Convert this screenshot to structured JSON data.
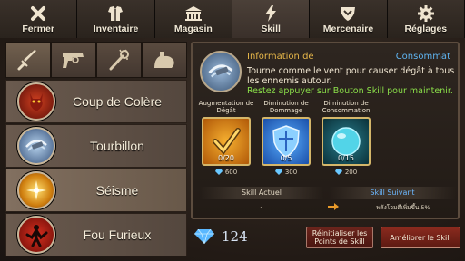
{
  "tabs": [
    {
      "id": "fermer",
      "label": "Fermer",
      "icon": "close-icon",
      "active": false
    },
    {
      "id": "inventaire",
      "label": "Inventaire",
      "icon": "armor-icon",
      "active": false
    },
    {
      "id": "magasin",
      "label": "Magasin",
      "icon": "shop-icon",
      "active": false
    },
    {
      "id": "skill",
      "label": "Skill",
      "icon": "lightning-icon",
      "active": true
    },
    {
      "id": "mercenaire",
      "label": "Mercenaire",
      "icon": "shield-badge-icon",
      "active": false
    },
    {
      "id": "reglages",
      "label": "Réglages",
      "icon": "gear-icon",
      "active": false
    }
  ],
  "weapon_tabs": [
    "sword-icon",
    "pistol-icon",
    "staff-icon",
    "flex-arm-icon"
  ],
  "skills": [
    {
      "name": "Coup de Colère",
      "icon": "rage-demon-icon",
      "active": false
    },
    {
      "name": "Tourbillon",
      "icon": "whirlwind-icon",
      "active": false
    },
    {
      "name": "Séisme",
      "icon": "quake-icon",
      "active": true
    },
    {
      "name": "Fou Furieux",
      "icon": "berserk-icon",
      "active": false
    }
  ],
  "info": {
    "title": "Information de",
    "cost_label": "Consommat",
    "description": "Tourne comme le vent pour causer dégât à tous les ennemis autour.",
    "hint": "Restez appuyer sur Bouton Skill pour maintenir."
  },
  "upgrades": [
    {
      "label": "Augmentation de Dégât",
      "level": "0/20",
      "cost": "600",
      "icon": "sword-check-icon"
    },
    {
      "label": "Diminution de Dommage",
      "level": "0/5",
      "cost": "300",
      "icon": "blue-shield-icon"
    },
    {
      "label": "Diminution de Consommation",
      "level": "0/15",
      "cost": "200",
      "icon": "mana-orb-icon"
    }
  ],
  "skill_actuel": {
    "label": "Skill Actuel",
    "value": "-"
  },
  "skill_suivant": {
    "label": "Skill Suivant",
    "value": "พลังโจมตีเพิ่มขึ้น 5%"
  },
  "gems_total": "124",
  "buttons": {
    "reset": "Réinitialiser les Points de Skill",
    "upgrade": "Améliorer le Skill"
  },
  "colors": {
    "accent_gold": "#e8b84a",
    "accent_blue": "#5fb4f0",
    "hint_green": "#8be04a",
    "button_red": "#6b241c"
  }
}
